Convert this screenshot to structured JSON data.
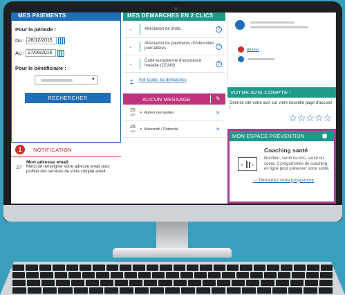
{
  "payments": {
    "header": "MES PAIEMENTS",
    "period_label": "Pour la période :",
    "from_label": "Du :",
    "from_value": "28/12/2015",
    "to_label": "Au :",
    "to_value": "27/06/2016",
    "beneficiary_label": "Pour le bénéficiaire :",
    "search_button": "RECHERCHER"
  },
  "notification": {
    "count": "1",
    "title": "NOTIFICATION",
    "day": "27",
    "heading": "Mon adresse email",
    "text": "Merci de renseigner votre adresse email pour profiter des services de votre compte ameli."
  },
  "demarches": {
    "header": "MES DÉMARCHES EN 2 CLICS",
    "items": [
      "Attestation de droits",
      "Attestation de paiements d'indemnités journalières",
      "Carte européenne d'assurance maladie (CEAM)"
    ],
    "all_link": "Voir toutes les démarches"
  },
  "messages": {
    "header": "AUCUN MESSAGE",
    "items": [
      {
        "day": "26",
        "month": "AVR",
        "label": "Autres demandes"
      },
      {
        "day": "26",
        "month": "AVR",
        "label": "Maternité / Paternité"
      }
    ]
  },
  "profile": {
    "add_link": "Ajouter"
  },
  "avis": {
    "header": "VOTRE AVIS COMPTE !",
    "text": "Donnez vite votre avis sur votre nouvelle page d'accueil !",
    "stars": "☆☆☆☆☆"
  },
  "prevention": {
    "header": "MON ESPACE PRÉVENTION",
    "title": "Coaching santé",
    "description": "Nutrition, santé du dos, santé du coeur: 3 programmes de coaching en ligne pour préserver votre santé.",
    "link": "Démarrez votre programme"
  },
  "colors": {
    "brand_blue": "#1f6fb8",
    "teal": "#1d9a8a",
    "magenta": "#c2327e",
    "highlight_border": "#a83b8e",
    "background": "#3a9fbd"
  }
}
